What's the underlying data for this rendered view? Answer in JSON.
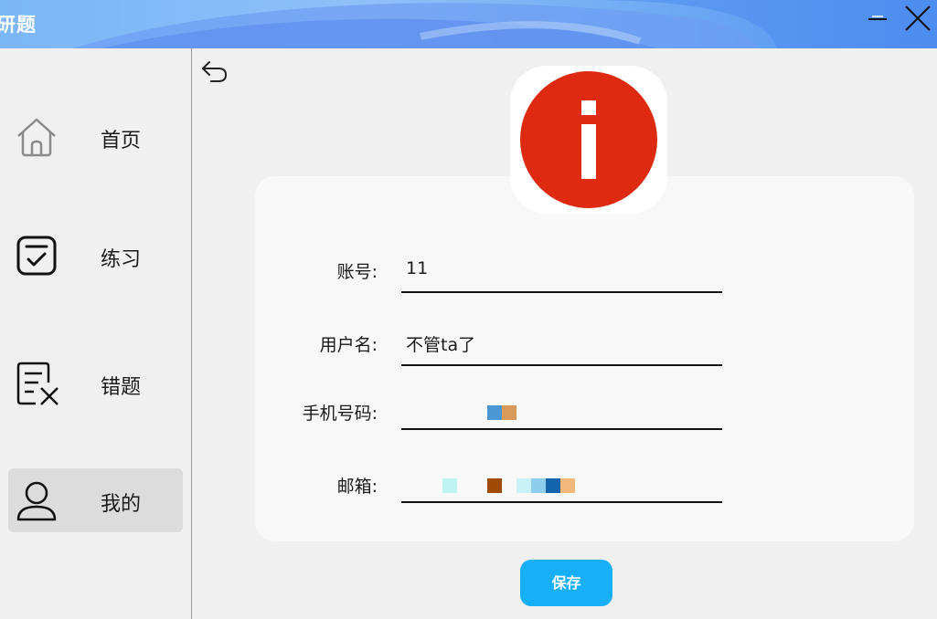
{
  "window": {
    "title": "研题",
    "minimize_icon": "minimize-icon",
    "close_icon": "close-icon",
    "accent_color": "#5b9bf3"
  },
  "sidebar": {
    "items": [
      {
        "label": "首页",
        "icon": "home-icon",
        "active": false
      },
      {
        "label": "练习",
        "icon": "checklist-icon",
        "active": false
      },
      {
        "label": "错题",
        "icon": "wrong-list-icon",
        "active": false
      },
      {
        "label": "我的",
        "icon": "user-icon",
        "active": true
      }
    ]
  },
  "main": {
    "back_icon": "back-arrow-icon",
    "avatar_icon": "info-icon",
    "avatar_color": "#dd2a10",
    "fields": [
      {
        "label": "账号:",
        "value": "11"
      },
      {
        "label": "用户名:",
        "value": "不管ta了"
      },
      {
        "label": "手机号码:",
        "value": ""
      },
      {
        "label": "邮箱:",
        "value": ""
      }
    ],
    "save_label": "保存",
    "save_color": "#17b0f8"
  }
}
